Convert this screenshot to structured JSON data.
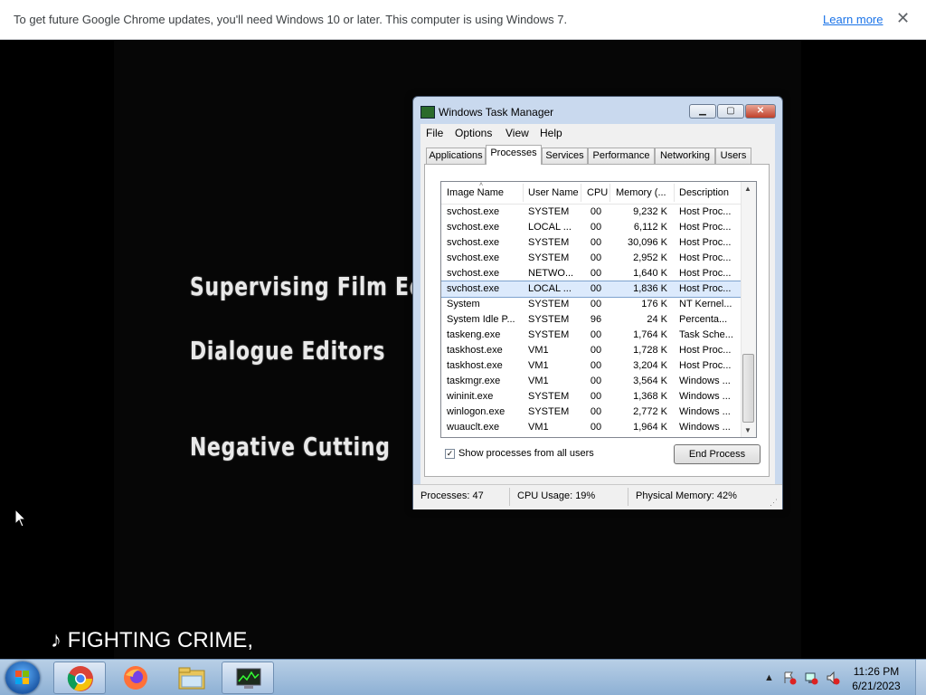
{
  "infobar": {
    "message": "To get future Google Chrome updates, you'll need Windows 10 or later. This computer is using Windows 7.",
    "learn_more": "Learn more",
    "close_glyph": "✕"
  },
  "video": {
    "credits": [
      "Supervising Film Edit",
      "Dialogue Editors",
      "Negative Cutting"
    ],
    "subtitle": "♪ FIGHTING CRIME,"
  },
  "task_manager": {
    "title": "Windows Task Manager",
    "window_buttons": {
      "minimize": "▁",
      "maximize": "▢",
      "close": "✕"
    },
    "menus": [
      "File",
      "Options",
      "View",
      "Help"
    ],
    "tabs": [
      "Applications",
      "Processes",
      "Services",
      "Performance",
      "Networking",
      "Users"
    ],
    "active_tab": "Processes",
    "columns": [
      "Image Name",
      "User Name",
      "CPU",
      "Memory (...",
      "Description"
    ],
    "rows": [
      {
        "name": "svchost.exe",
        "user": "SYSTEM",
        "cpu": "00",
        "mem": "9,232 K",
        "desc": "Host Proc..."
      },
      {
        "name": "svchost.exe",
        "user": "LOCAL ...",
        "cpu": "00",
        "mem": "6,112 K",
        "desc": "Host Proc..."
      },
      {
        "name": "svchost.exe",
        "user": "SYSTEM",
        "cpu": "00",
        "mem": "30,096 K",
        "desc": "Host Proc..."
      },
      {
        "name": "svchost.exe",
        "user": "SYSTEM",
        "cpu": "00",
        "mem": "2,952 K",
        "desc": "Host Proc..."
      },
      {
        "name": "svchost.exe",
        "user": "NETWO...",
        "cpu": "00",
        "mem": "1,640 K",
        "desc": "Host Proc..."
      },
      {
        "name": "svchost.exe",
        "user": "LOCAL ...",
        "cpu": "00",
        "mem": "1,836 K",
        "desc": "Host Proc...",
        "selected": true
      },
      {
        "name": "System",
        "user": "SYSTEM",
        "cpu": "00",
        "mem": "176 K",
        "desc": "NT Kernel..."
      },
      {
        "name": "System Idle P...",
        "user": "SYSTEM",
        "cpu": "96",
        "mem": "24 K",
        "desc": "Percenta..."
      },
      {
        "name": "taskeng.exe",
        "user": "SYSTEM",
        "cpu": "00",
        "mem": "1,764 K",
        "desc": "Task Sche..."
      },
      {
        "name": "taskhost.exe",
        "user": "VM1",
        "cpu": "00",
        "mem": "1,728 K",
        "desc": "Host Proc..."
      },
      {
        "name": "taskhost.exe",
        "user": "VM1",
        "cpu": "00",
        "mem": "3,204 K",
        "desc": "Host Proc..."
      },
      {
        "name": "taskmgr.exe",
        "user": "VM1",
        "cpu": "00",
        "mem": "3,564 K",
        "desc": "Windows ..."
      },
      {
        "name": "wininit.exe",
        "user": "SYSTEM",
        "cpu": "00",
        "mem": "1,368 K",
        "desc": "Windows ..."
      },
      {
        "name": "winlogon.exe",
        "user": "SYSTEM",
        "cpu": "00",
        "mem": "2,772 K",
        "desc": "Windows ..."
      },
      {
        "name": "wuauclt.exe",
        "user": "VM1",
        "cpu": "00",
        "mem": "1,964 K",
        "desc": "Windows ..."
      }
    ],
    "show_all_users_label": "Show processes from all users",
    "show_all_users_checked": true,
    "check_glyph": "✓",
    "end_process": "End Process",
    "status": {
      "processes": "Processes: 47",
      "cpu": "CPU Usage: 19%",
      "memory": "Physical Memory: 42%"
    }
  },
  "taskbar": {
    "pinned": [
      "chrome-icon",
      "firefox-icon",
      "explorer-icon",
      "task-manager-icon"
    ],
    "tray": {
      "up_arrow": "▲"
    },
    "clock": {
      "time": "11:26 PM",
      "date": "6/21/2023"
    }
  }
}
